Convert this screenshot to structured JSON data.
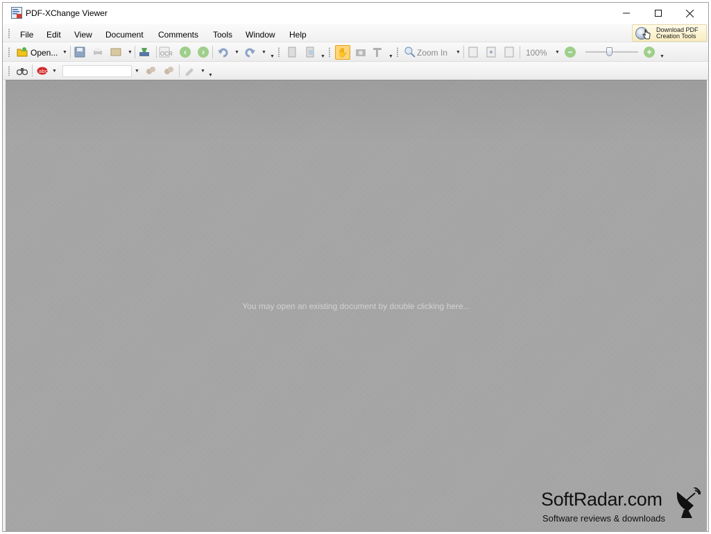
{
  "window": {
    "title": "PDF-XChange Viewer"
  },
  "menubar": {
    "items": [
      {
        "label": "File"
      },
      {
        "label": "Edit"
      },
      {
        "label": "View"
      },
      {
        "label": "Document"
      },
      {
        "label": "Comments"
      },
      {
        "label": "Tools"
      },
      {
        "label": "Window"
      },
      {
        "label": "Help"
      }
    ],
    "promo": {
      "line1": "Download PDF",
      "line2": "Creation Tools"
    }
  },
  "toolbar": {
    "open_label": "Open...",
    "ocr_label": "OCR",
    "zoom_in_label": "Zoom In",
    "zoom_value": "100%",
    "zoom_slider_level": 0.45
  },
  "search_toolbar": {
    "search_value": ""
  },
  "canvas": {
    "hint": "You may open an existing document by double clicking here..."
  },
  "watermark": {
    "title": "SoftRadar.com",
    "subtitle": "Software reviews & downloads"
  },
  "colors": {
    "active_tool_bg": "#ffd57a",
    "canvas_bg": "#a6a6a6"
  },
  "icons": [
    "app-icon",
    "minimize-icon",
    "maximize-icon",
    "close-icon",
    "open-folder-icon",
    "save-icon",
    "print-icon",
    "email-icon",
    "scan-icon",
    "ocr-icon",
    "back-icon",
    "forward-icon",
    "undo-icon",
    "redo-icon",
    "page-icon",
    "hand-tool-icon",
    "snapshot-icon",
    "select-text-icon",
    "zoom-in-icon",
    "zoom-out-icon",
    "binoculars-icon",
    "spell-check-icon",
    "satellite-dish-icon"
  ]
}
